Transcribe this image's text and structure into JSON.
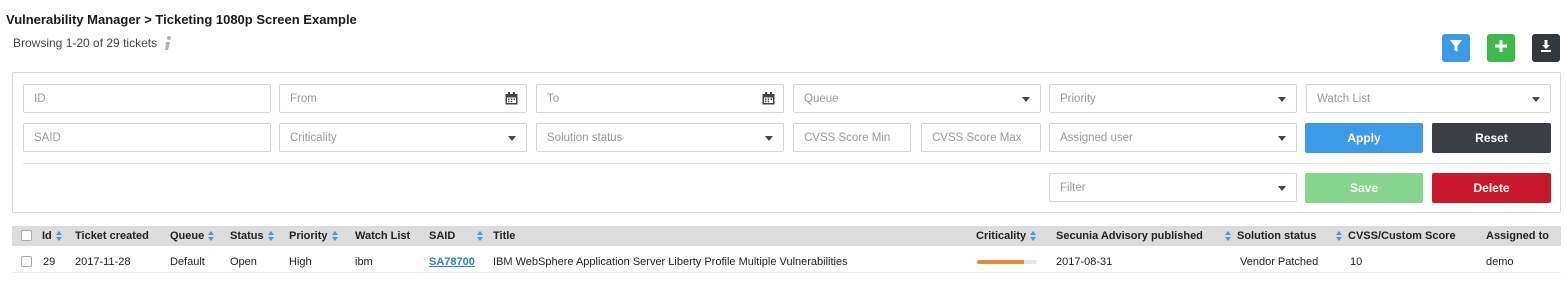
{
  "header": {
    "title": "Vulnerability Manager > Ticketing 1080p Screen Example",
    "browse_text": "Browsing 1-20 of 29 tickets"
  },
  "toolbar": {
    "icons": [
      "filter-icon",
      "plus-icon",
      "download-icon"
    ],
    "colors": {
      "filter": "#3d9ae8",
      "add": "#41b94a",
      "download": "#333740"
    }
  },
  "filters": {
    "id": "ID",
    "from": "From",
    "to": "To",
    "queue": "Queue",
    "priority": "Priority",
    "watch_list": "Watch List",
    "said": "SAID",
    "criticality": "Criticality",
    "solution_status": "Solution status",
    "cvss_min": "CVSS Score Min",
    "cvss_max": "CVSS Score Max",
    "assigned_user": "Assigned user",
    "filter": "Filter"
  },
  "buttons": {
    "apply": "Apply",
    "reset": "Reset",
    "save": "Save",
    "delete": "Delete"
  },
  "table": {
    "columns": {
      "id": "Id",
      "ticket_created": "Ticket created",
      "queue": "Queue",
      "status": "Status",
      "priority": "Priority",
      "watch_list": "Watch List",
      "said": "SAID",
      "title": "Title",
      "criticality": "Criticality",
      "secunia_published": "Secunia Advisory published",
      "solution_status": "Solution status",
      "cvss": "CVSS/Custom Score",
      "assigned_to": "Assigned to"
    },
    "rows": [
      {
        "id": "29",
        "ticket_created": "2017-11-28",
        "queue": "Default",
        "status": "Open",
        "priority": "High",
        "watch_list": "ibm",
        "said": "SA78700",
        "title": "IBM WebSphere Application Server Liberty Profile Multiple Vulnerabilities",
        "criticality_level": 0.78,
        "secunia_published": "2017-08-31",
        "solution_status": "Vendor Patched",
        "cvss": "10",
        "assigned_to": "demo"
      }
    ]
  }
}
